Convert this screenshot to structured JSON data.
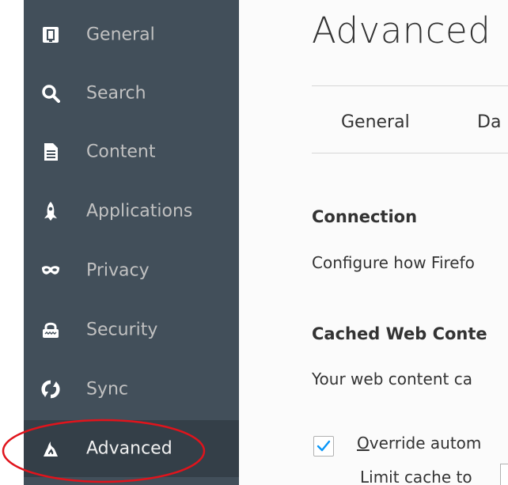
{
  "window": {
    "title": "Advanced"
  },
  "sidebar": {
    "items": [
      {
        "label": "General",
        "icon": "general-icon"
      },
      {
        "label": "Search",
        "icon": "search-icon"
      },
      {
        "label": "Content",
        "icon": "content-icon"
      },
      {
        "label": "Applications",
        "icon": "applications-icon"
      },
      {
        "label": "Privacy",
        "icon": "privacy-icon"
      },
      {
        "label": "Security",
        "icon": "security-icon"
      },
      {
        "label": "Sync",
        "icon": "sync-icon"
      },
      {
        "label": "Advanced",
        "icon": "advanced-icon",
        "selected": true
      }
    ]
  },
  "main": {
    "title": "Advanced",
    "tabs": [
      {
        "label": "General"
      },
      {
        "label": "Da"
      }
    ],
    "connection": {
      "heading": "Connection",
      "description": "Configure how Firefo"
    },
    "cache": {
      "heading": "Cached Web Conte",
      "description": "Your web content ca",
      "override_checkbox": {
        "checked": true,
        "accesskey": "O",
        "label_rest": "verride autom"
      },
      "limit_label": "Limit cache to"
    }
  },
  "colors": {
    "sidebar_bg": "#424f5a",
    "sidebar_selected_bg": "#343f48",
    "sidebar_text": "#c1c1c1",
    "content_bg": "#fbfbfb",
    "accent": "#0996f8",
    "annotation": "#e0141c"
  }
}
